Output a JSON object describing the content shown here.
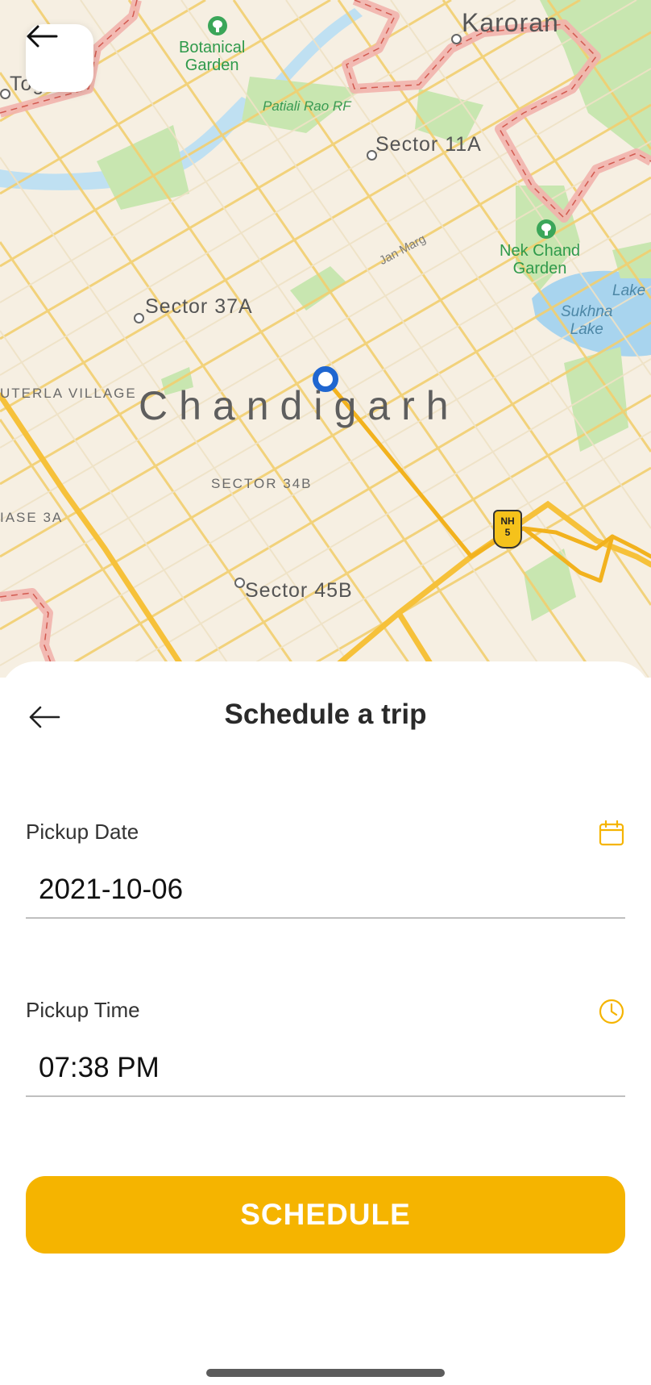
{
  "map": {
    "city_label": "Chandigarh",
    "labels": {
      "karoran": "Karoran",
      "togan": "Togan",
      "botanical_garden": "Botanical\nGarden",
      "patiali_rao": "Patiali Rao RF",
      "sector_11a": "Sector 11A",
      "jan_marg": "Jan Marg",
      "nek_chand": "Nek Chand\nGarden",
      "lake": "Lake",
      "sukhna_lake": "Sukhna\nLake",
      "sector_37a": "Sector 37A",
      "buterla_village": "UTERLA VILLAGE",
      "sector_34b": "SECTOR 34B",
      "phase_3a": "IASE 3A",
      "sector_45b": "Sector 45B"
    },
    "highway_shield": {
      "top": "NH",
      "number": "5"
    },
    "colors": {
      "land": "#f6efe2",
      "road": "#f2cf70",
      "highway": "#f6c13a",
      "route": "#f2b21e",
      "park": "#c8e6b0",
      "water": "#a8d4ee",
      "boundary": "#f2b3ad",
      "pin": "#1f66d0"
    }
  },
  "header": {
    "title": "Schedule a trip"
  },
  "form": {
    "pickup_date": {
      "label": "Pickup Date",
      "value": "2021-10-06",
      "icon": "calendar-icon"
    },
    "pickup_time": {
      "label": "Pickup Time",
      "value": "07:38 PM",
      "icon": "clock-icon"
    }
  },
  "actions": {
    "schedule_label": "SCHEDULE"
  },
  "theme": {
    "accent": "#f5b400"
  }
}
